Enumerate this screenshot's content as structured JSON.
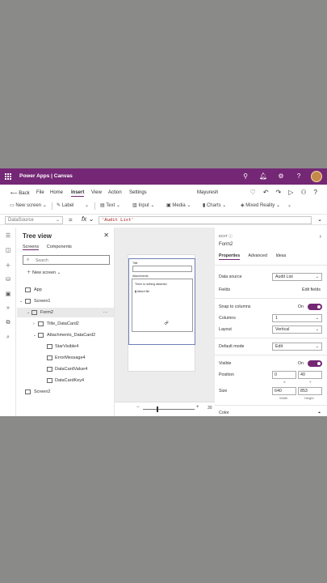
{
  "titlebar": {
    "app": "Power Apps  |  Canvas"
  },
  "menu": {
    "back": "Back",
    "file": "File",
    "home": "Home",
    "insert": "Insert",
    "view": "View",
    "action": "Action",
    "settings": "Settings",
    "user": "Mayuresh"
  },
  "cmd": {
    "new_screen": "New screen",
    "label": "Label",
    "text": "Text",
    "input": "Input",
    "media": "Media",
    "charts": "Charts",
    "mixed_reality": "Mixed Reality"
  },
  "formula": {
    "property": "DataSource",
    "value": "'Audit List'"
  },
  "tree": {
    "title": "Tree view",
    "tabs": [
      "Screens",
      "Components"
    ],
    "search_placeholder": "Search",
    "new_screen": "New screen",
    "nodes": [
      "App",
      "Screen1",
      "Form2",
      "Title_DataCard2",
      "Attachments_DataCard2",
      "StarVisible4",
      "ErrorMessage4",
      "DataCardValue4",
      "DataCardKey4",
      "Screen2"
    ]
  },
  "canvas": {
    "title_label": "Title",
    "attachments_label": "Attachments",
    "no_attach": "There is nothing attached.",
    "attach_file": "Attach file",
    "zoom": "30"
  },
  "props": {
    "edit": "EDIT",
    "name": "Form2",
    "tabs": [
      "Properties",
      "Advanced",
      "Ideas"
    ],
    "data_source_label": "Data source",
    "data_source_value": "Audit List",
    "fields_label": "Fields",
    "edit_fields": "Edit fields",
    "snap_label": "Snap to columns",
    "snap_value": "On",
    "columns_label": "Columns",
    "columns_value": "1",
    "layout_label": "Layout",
    "layout_value": "Vertical",
    "default_mode_label": "Default mode",
    "default_mode_value": "Edit",
    "visible_label": "Visible",
    "visible_value": "On",
    "position_label": "Position",
    "pos_x": "0",
    "pos_y": "40",
    "x_cap": "X",
    "y_cap": "Y",
    "size_label": "Size",
    "width": "640",
    "height": "853",
    "width_cap": "Width",
    "height_cap": "Height",
    "color_label": "Color"
  },
  "colors": {
    "brand": "#742774",
    "toggle": "#742774"
  }
}
